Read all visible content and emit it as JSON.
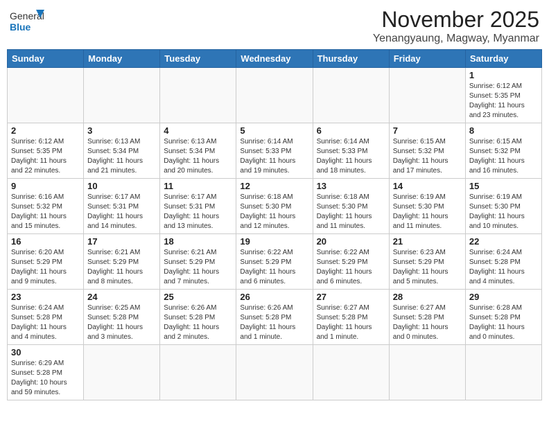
{
  "logo": {
    "text_general": "General",
    "text_blue": "Blue"
  },
  "title": "November 2025",
  "subtitle": "Yenangyaung, Magway, Myanmar",
  "weekdays": [
    "Sunday",
    "Monday",
    "Tuesday",
    "Wednesday",
    "Thursday",
    "Friday",
    "Saturday"
  ],
  "weeks": [
    [
      {
        "day": null,
        "info": null
      },
      {
        "day": null,
        "info": null
      },
      {
        "day": null,
        "info": null
      },
      {
        "day": null,
        "info": null
      },
      {
        "day": null,
        "info": null
      },
      {
        "day": null,
        "info": null
      },
      {
        "day": "1",
        "info": "Sunrise: 6:12 AM\nSunset: 5:35 PM\nDaylight: 11 hours\nand 23 minutes."
      }
    ],
    [
      {
        "day": "2",
        "info": "Sunrise: 6:12 AM\nSunset: 5:35 PM\nDaylight: 11 hours\nand 22 minutes."
      },
      {
        "day": "3",
        "info": "Sunrise: 6:13 AM\nSunset: 5:34 PM\nDaylight: 11 hours\nand 21 minutes."
      },
      {
        "day": "4",
        "info": "Sunrise: 6:13 AM\nSunset: 5:34 PM\nDaylight: 11 hours\nand 20 minutes."
      },
      {
        "day": "5",
        "info": "Sunrise: 6:14 AM\nSunset: 5:33 PM\nDaylight: 11 hours\nand 19 minutes."
      },
      {
        "day": "6",
        "info": "Sunrise: 6:14 AM\nSunset: 5:33 PM\nDaylight: 11 hours\nand 18 minutes."
      },
      {
        "day": "7",
        "info": "Sunrise: 6:15 AM\nSunset: 5:32 PM\nDaylight: 11 hours\nand 17 minutes."
      },
      {
        "day": "8",
        "info": "Sunrise: 6:15 AM\nSunset: 5:32 PM\nDaylight: 11 hours\nand 16 minutes."
      }
    ],
    [
      {
        "day": "9",
        "info": "Sunrise: 6:16 AM\nSunset: 5:32 PM\nDaylight: 11 hours\nand 15 minutes."
      },
      {
        "day": "10",
        "info": "Sunrise: 6:17 AM\nSunset: 5:31 PM\nDaylight: 11 hours\nand 14 minutes."
      },
      {
        "day": "11",
        "info": "Sunrise: 6:17 AM\nSunset: 5:31 PM\nDaylight: 11 hours\nand 13 minutes."
      },
      {
        "day": "12",
        "info": "Sunrise: 6:18 AM\nSunset: 5:30 PM\nDaylight: 11 hours\nand 12 minutes."
      },
      {
        "day": "13",
        "info": "Sunrise: 6:18 AM\nSunset: 5:30 PM\nDaylight: 11 hours\nand 11 minutes."
      },
      {
        "day": "14",
        "info": "Sunrise: 6:19 AM\nSunset: 5:30 PM\nDaylight: 11 hours\nand 11 minutes."
      },
      {
        "day": "15",
        "info": "Sunrise: 6:19 AM\nSunset: 5:30 PM\nDaylight: 11 hours\nand 10 minutes."
      }
    ],
    [
      {
        "day": "16",
        "info": "Sunrise: 6:20 AM\nSunset: 5:29 PM\nDaylight: 11 hours\nand 9 minutes."
      },
      {
        "day": "17",
        "info": "Sunrise: 6:21 AM\nSunset: 5:29 PM\nDaylight: 11 hours\nand 8 minutes."
      },
      {
        "day": "18",
        "info": "Sunrise: 6:21 AM\nSunset: 5:29 PM\nDaylight: 11 hours\nand 7 minutes."
      },
      {
        "day": "19",
        "info": "Sunrise: 6:22 AM\nSunset: 5:29 PM\nDaylight: 11 hours\nand 6 minutes."
      },
      {
        "day": "20",
        "info": "Sunrise: 6:22 AM\nSunset: 5:29 PM\nDaylight: 11 hours\nand 6 minutes."
      },
      {
        "day": "21",
        "info": "Sunrise: 6:23 AM\nSunset: 5:29 PM\nDaylight: 11 hours\nand 5 minutes."
      },
      {
        "day": "22",
        "info": "Sunrise: 6:24 AM\nSunset: 5:28 PM\nDaylight: 11 hours\nand 4 minutes."
      }
    ],
    [
      {
        "day": "23",
        "info": "Sunrise: 6:24 AM\nSunset: 5:28 PM\nDaylight: 11 hours\nand 4 minutes."
      },
      {
        "day": "24",
        "info": "Sunrise: 6:25 AM\nSunset: 5:28 PM\nDaylight: 11 hours\nand 3 minutes."
      },
      {
        "day": "25",
        "info": "Sunrise: 6:26 AM\nSunset: 5:28 PM\nDaylight: 11 hours\nand 2 minutes."
      },
      {
        "day": "26",
        "info": "Sunrise: 6:26 AM\nSunset: 5:28 PM\nDaylight: 11 hours\nand 1 minute."
      },
      {
        "day": "27",
        "info": "Sunrise: 6:27 AM\nSunset: 5:28 PM\nDaylight: 11 hours\nand 1 minute."
      },
      {
        "day": "28",
        "info": "Sunrise: 6:27 AM\nSunset: 5:28 PM\nDaylight: 11 hours\nand 0 minutes."
      },
      {
        "day": "29",
        "info": "Sunrise: 6:28 AM\nSunset: 5:28 PM\nDaylight: 11 hours\nand 0 minutes."
      }
    ],
    [
      {
        "day": "30",
        "info": "Sunrise: 6:29 AM\nSunset: 5:28 PM\nDaylight: 10 hours\nand 59 minutes."
      },
      {
        "day": null,
        "info": null
      },
      {
        "day": null,
        "info": null
      },
      {
        "day": null,
        "info": null
      },
      {
        "day": null,
        "info": null
      },
      {
        "day": null,
        "info": null
      },
      {
        "day": null,
        "info": null
      }
    ]
  ]
}
